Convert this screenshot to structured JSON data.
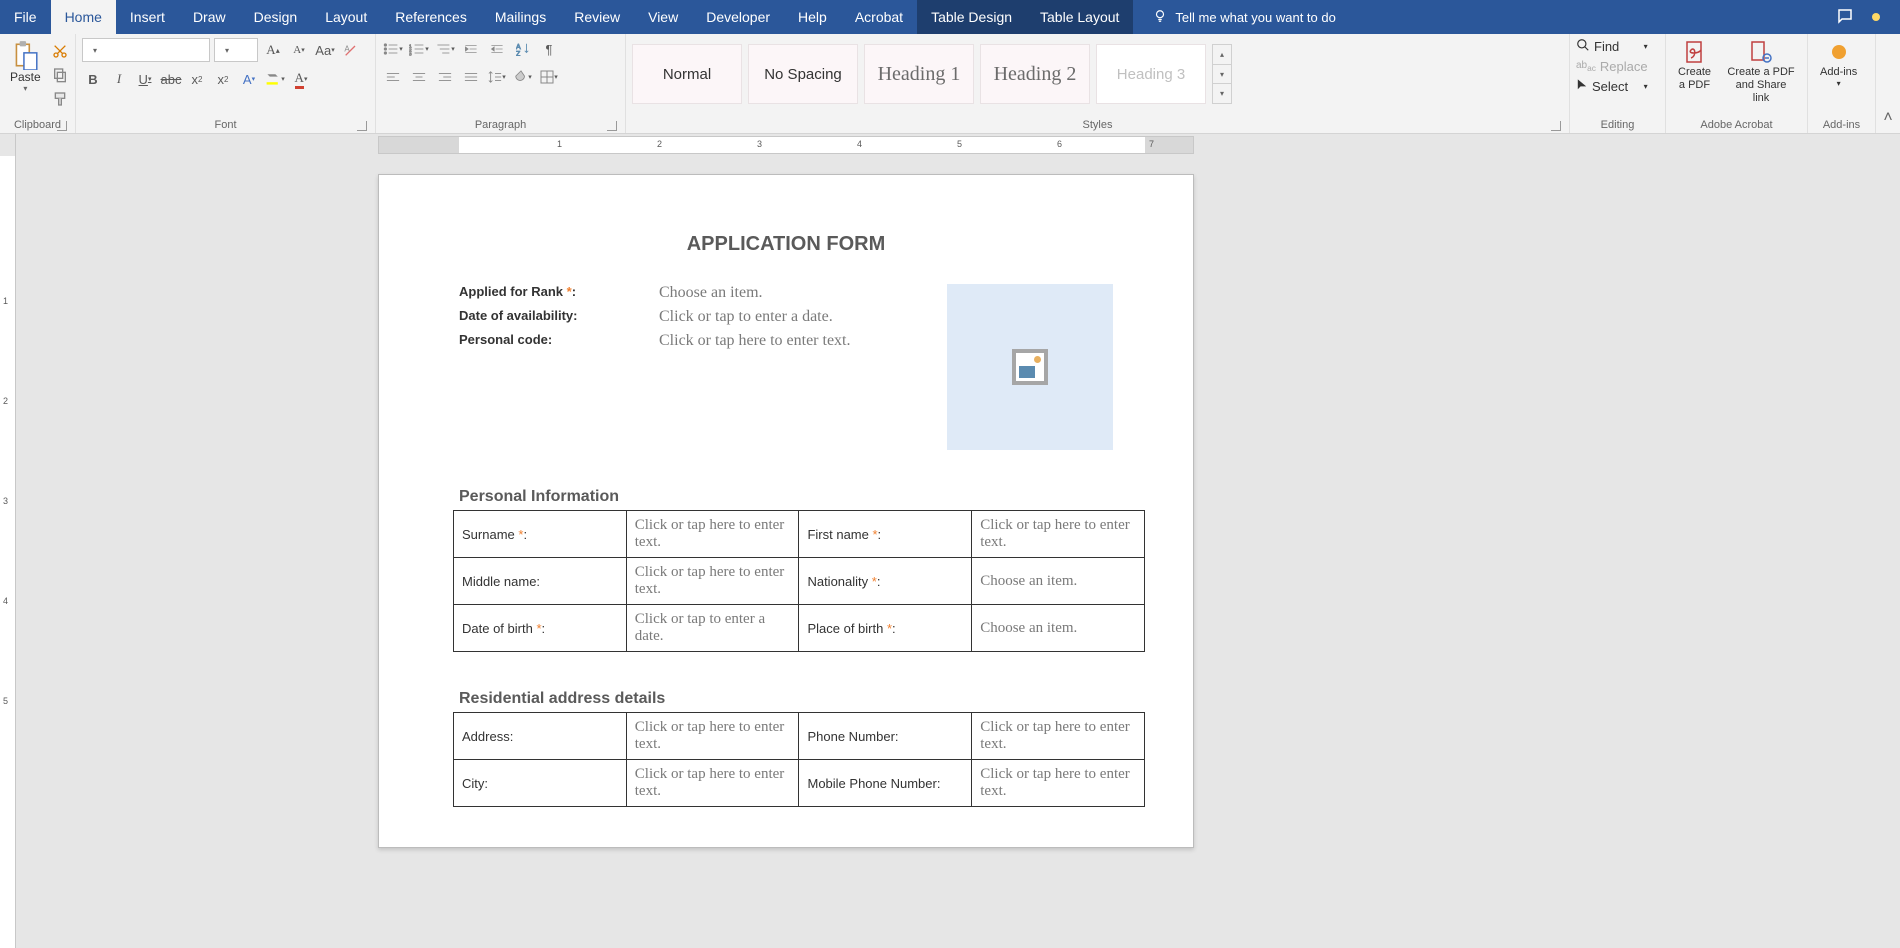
{
  "ribbon": {
    "tabs": [
      "File",
      "Home",
      "Insert",
      "Draw",
      "Design",
      "Layout",
      "References",
      "Mailings",
      "Review",
      "View",
      "Developer",
      "Help",
      "Acrobat",
      "Table Design",
      "Table Layout"
    ],
    "tellme": "Tell me what you want to do",
    "groups": {
      "clipboard": {
        "label": "Clipboard",
        "paste": "Paste"
      },
      "font": {
        "label": "Font"
      },
      "paragraph": {
        "label": "Paragraph"
      },
      "styles": {
        "label": "Styles",
        "items": [
          "Normal",
          "No Spacing",
          "Heading 1",
          "Heading 2",
          "Heading 3"
        ]
      },
      "editing": {
        "label": "Editing",
        "find": "Find",
        "replace": "Replace",
        "select": "Select"
      },
      "acrobat": {
        "label": "Adobe Acrobat",
        "b1a": "Create",
        "b1b": "a PDF",
        "b2a": "Create a PDF",
        "b2b": "and Share link"
      },
      "addins": {
        "label": "Add-ins",
        "btn": "Add-ins"
      }
    }
  },
  "doc": {
    "title": "APPLICATION FORM",
    "top": {
      "rank": {
        "label": "Applied for Rank ",
        "ph": "Choose an item."
      },
      "avail": {
        "label": "Date of availability:",
        "ph": "Click or tap to enter a date."
      },
      "pcode": {
        "label": "Personal code:",
        "ph": "Click or tap here to enter text."
      }
    },
    "section1": "Personal Information",
    "tbl1": [
      {
        "l1": "Surname ",
        "v1": "Click or tap here to enter text.",
        "l2": "First name ",
        "v2": "Click or tap here to enter text."
      },
      {
        "l1": "Middle name:",
        "v1": "Click or tap here to enter text.",
        "l2": "Nationality ",
        "v2": "Choose an item."
      },
      {
        "l1": "Date of birth ",
        "v1": "Click or tap to enter a date.",
        "l2": "Place of birth ",
        "v2": "Choose an item."
      }
    ],
    "section2": "Residential address details",
    "tbl2": [
      {
        "l1": "Address:",
        "v1": "Click or tap here to enter text.",
        "l2": "Phone Number:",
        "v2": "Click or tap here to enter text."
      },
      {
        "l1": "City:",
        "v1": "Click or tap here to enter text.",
        "l2": "Mobile Phone Number:",
        "v2": "Click or tap here to enter text."
      }
    ]
  },
  "ruler": {
    "nums": [
      "1",
      "2",
      "3",
      "4",
      "5",
      "6",
      "7"
    ]
  },
  "vruler": {
    "nums": [
      "1",
      "2",
      "3",
      "4",
      "5"
    ]
  }
}
